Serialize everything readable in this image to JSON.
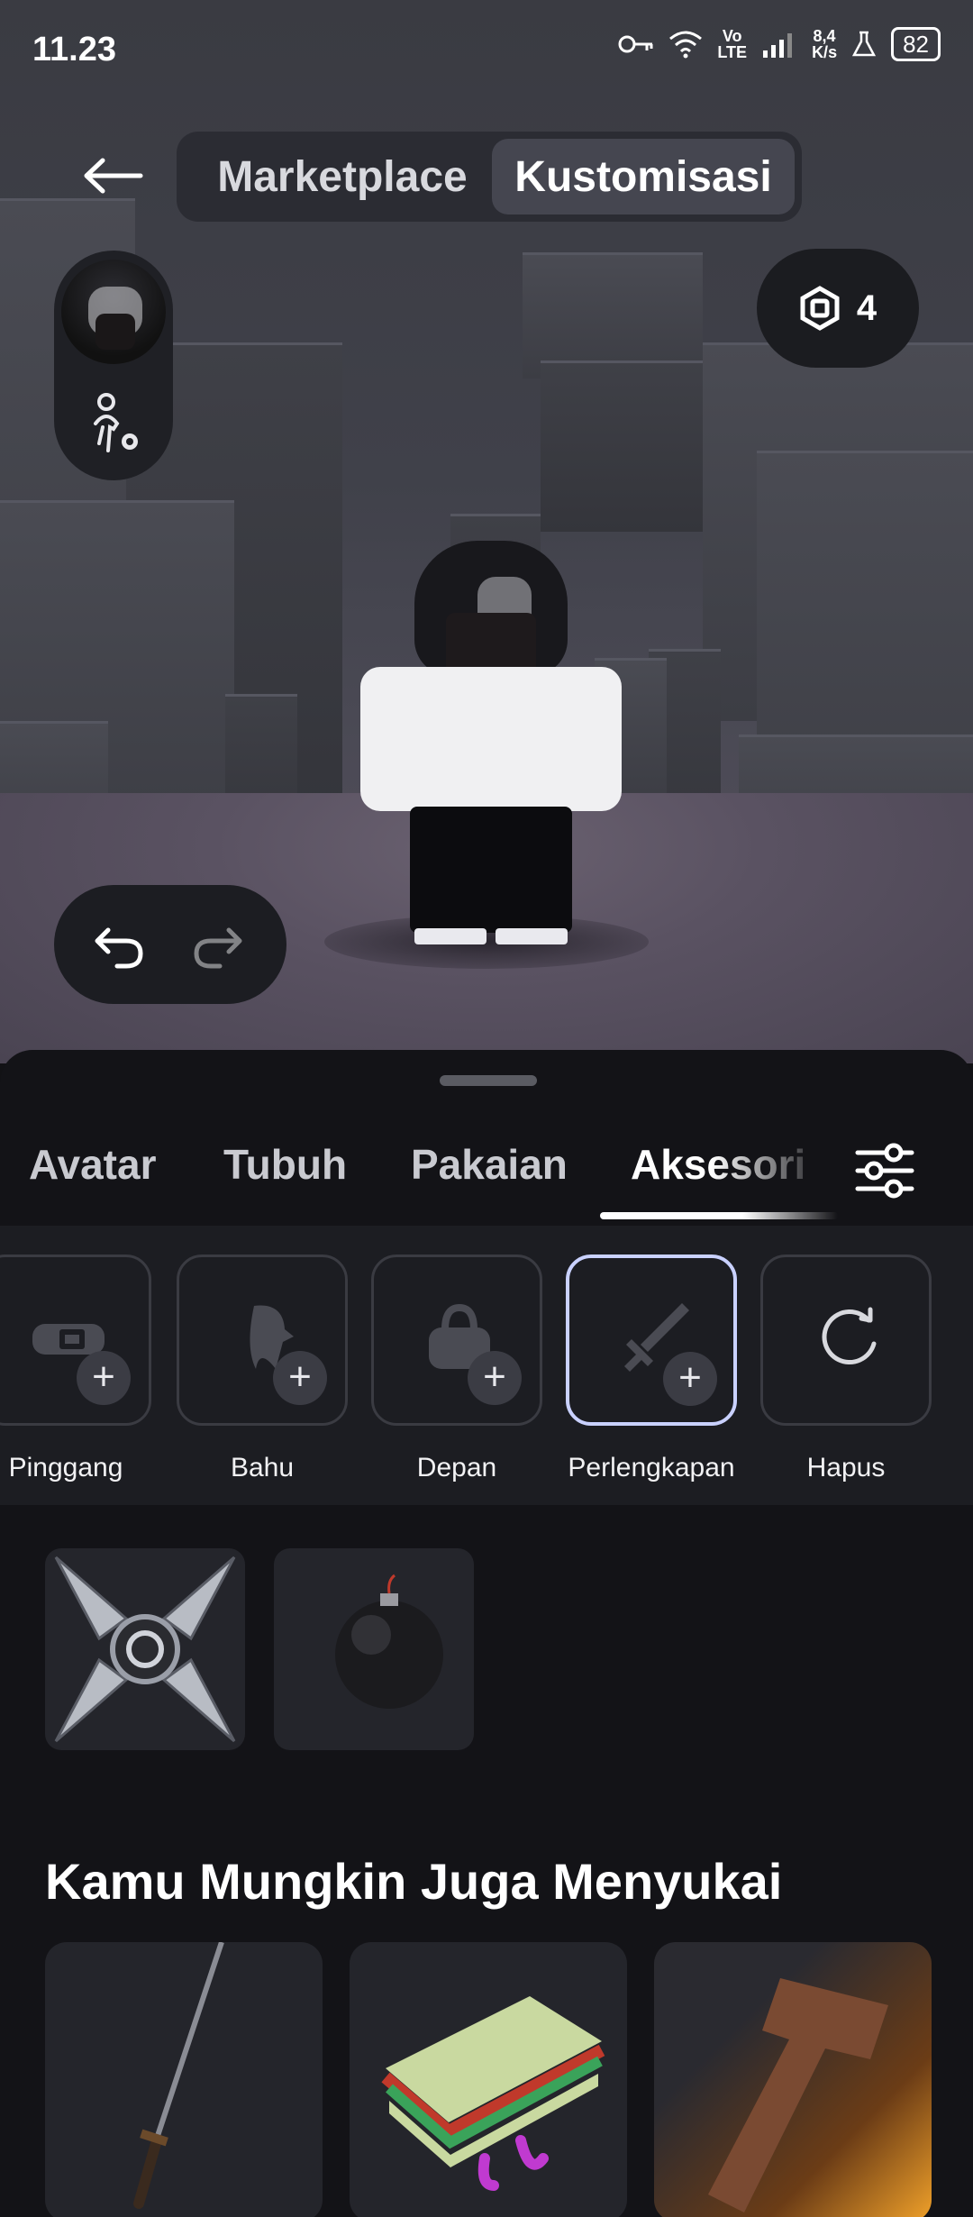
{
  "status_bar": {
    "time": "11.23",
    "net_speed_value": "8,4",
    "net_speed_unit": "K/s",
    "volte_top": "Vo",
    "volte_bottom": "LTE",
    "battery": "82"
  },
  "top_nav": {
    "tabs": [
      {
        "label": "Marketplace",
        "active": false
      },
      {
        "label": "Kustomisasi",
        "active": true
      }
    ]
  },
  "currency": {
    "icon": "robux-icon",
    "amount": "4"
  },
  "category_tabs": [
    {
      "label": "Avatar",
      "active": false
    },
    {
      "label": "Tubuh",
      "active": false
    },
    {
      "label": "Pakaian",
      "active": false
    },
    {
      "label": "Aksesori",
      "active": true
    }
  ],
  "subcategories": [
    {
      "label": "Pinggang",
      "icon": "belt-icon",
      "add": true,
      "selected": false
    },
    {
      "label": "Bahu",
      "icon": "shoulder-icon",
      "add": true,
      "selected": false
    },
    {
      "label": "Depan",
      "icon": "bag-icon",
      "add": true,
      "selected": false
    },
    {
      "label": "Perlengkapan",
      "icon": "sword-icon",
      "add": true,
      "selected": true
    },
    {
      "label": "Hapus",
      "icon": "reset-icon",
      "add": false,
      "selected": false
    }
  ],
  "equipped_items": [
    {
      "name": "shuriken-item",
      "icon": "shuriken-icon"
    },
    {
      "name": "bomb-item",
      "icon": "bomb-icon"
    }
  ],
  "recommendations": {
    "title": "Kamu Mungkin Juga Menyukai",
    "items": [
      {
        "icon": "katana-icon"
      },
      {
        "icon": "sandwich-icon"
      },
      {
        "icon": "hammer-icon"
      }
    ]
  },
  "colors": {
    "sheet_bg": "#131317",
    "strip_bg": "#1c1d22",
    "selected_border": "#c9d1ff",
    "card_bg": "#24252b"
  }
}
